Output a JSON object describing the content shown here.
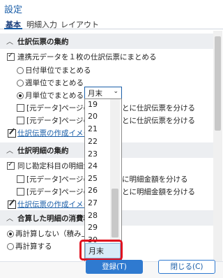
{
  "window": {
    "title": "設定"
  },
  "tabs": [
    {
      "label": "基本",
      "active": true
    },
    {
      "label": "明細入力",
      "active": false
    },
    {
      "label": "レイアウト",
      "active": false
    }
  ],
  "section1": {
    "header": "仕訳伝票の集約",
    "opt_merge": "連携元データを１枚の仕訳伝票にまとめる",
    "radio_daily": "日付単位でまとめる",
    "radio_weekly": "週単位でまとめる",
    "radio_monthly": "月単位でまとめる",
    "split1_a": "[元データ]ページの",
    "split1_b": "とに仕訳伝票を分ける",
    "split2_a": "[元データ]ページの",
    "split2_b": "とに仕訳伝票を分ける",
    "link": "仕訳伝票の作成イメー"
  },
  "section2": {
    "header": "仕訳明細の集約",
    "opt_same": "同じ勘定科目の明細金",
    "split1_a": "[元データ]ページの",
    "split1_b": "に明細金額を分ける",
    "split2_a": "[元データ]ページの",
    "split2_b": "とに明細金額を分ける",
    "link": "仕訳伝票の作成イメー"
  },
  "section3": {
    "header": "合算した明細の消費税",
    "radio_recalc_no": "再計算しない（積み上げ",
    "radio_recalc": "再計算する"
  },
  "select": {
    "value": "月末",
    "options": [
      "19",
      "20",
      "21",
      "22",
      "23",
      "24",
      "25",
      "26",
      "27",
      "28",
      "29",
      "30",
      "31",
      "月末"
    ],
    "selected": "月末"
  },
  "footer": {
    "register": "登録(T)",
    "close": "閉じる(C)"
  },
  "colors": {
    "accent": "#1a5ea8",
    "highlight": "#e0101e",
    "primary_button": "#2f7ad0"
  }
}
